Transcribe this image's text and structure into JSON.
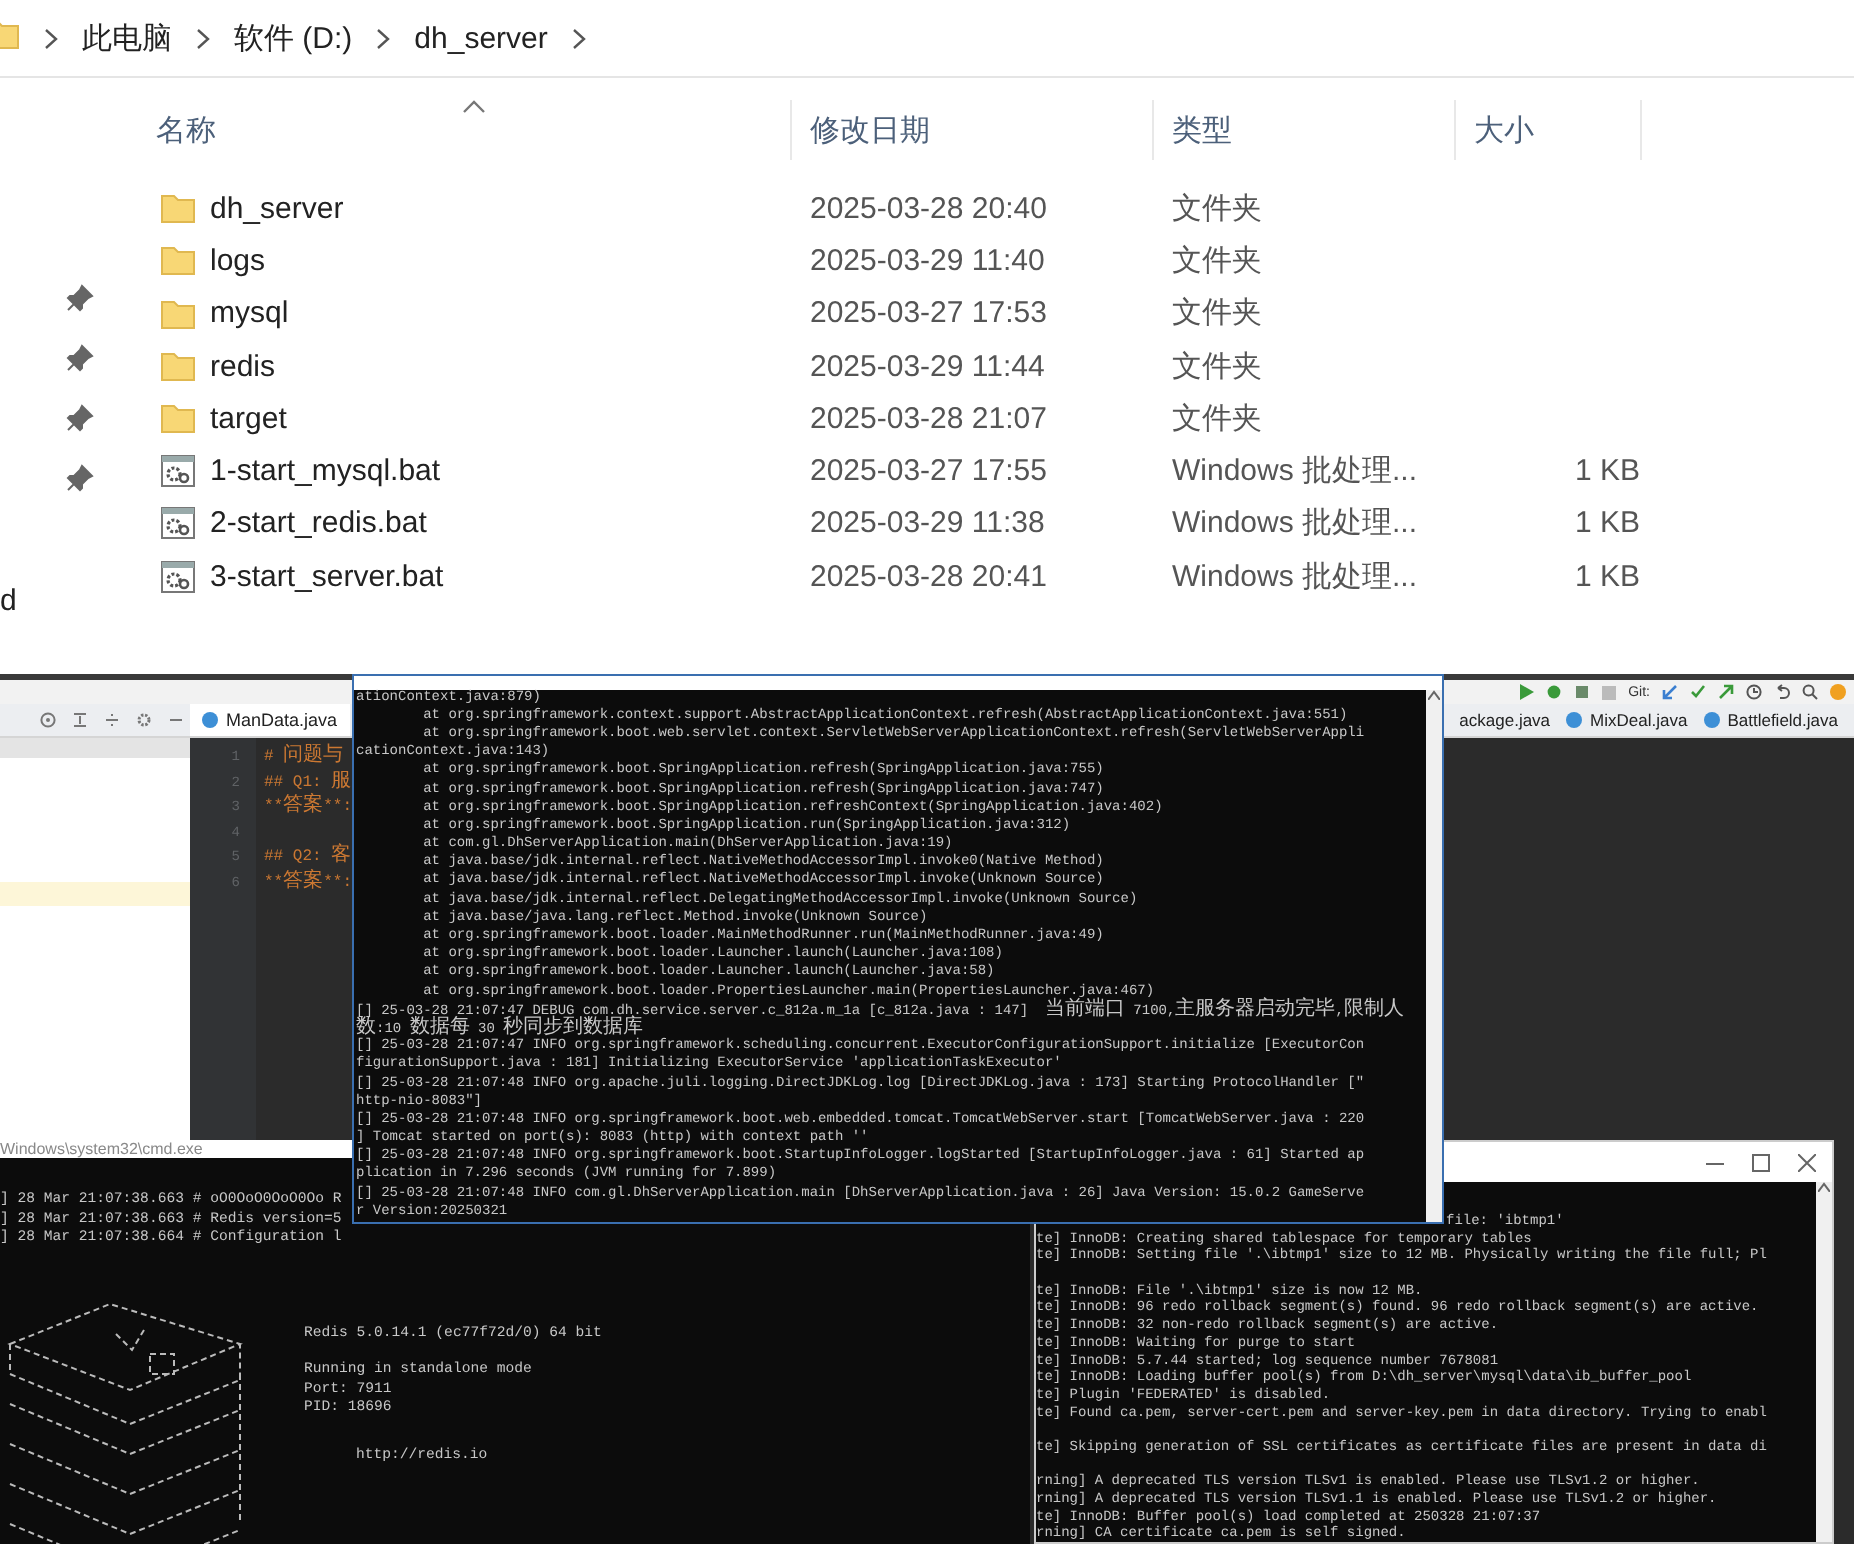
{
  "explorer": {
    "breadcrumb": [
      "此电脑",
      "软件 (D:)",
      "dh_server"
    ],
    "nav_fragment": "d",
    "columns": [
      {
        "label": "名称",
        "sorted": true
      },
      {
        "label": "修改日期",
        "sorted": false
      },
      {
        "label": "类型",
        "sorted": false
      },
      {
        "label": "大小",
        "sorted": false
      }
    ],
    "rows": [
      {
        "kind": "folder",
        "name": "dh_server",
        "date": "2025-03-28 20:40",
        "type": "文件夹"
      },
      {
        "kind": "folder",
        "name": "logs",
        "date": "2025-03-29 11:40",
        "type": "文件夹"
      },
      {
        "kind": "folder",
        "name": "mysql",
        "date": "2025-03-27 17:53",
        "type": "文件夹"
      },
      {
        "kind": "folder",
        "name": "redis",
        "date": "2025-03-29 11:44",
        "type": "文件夹"
      },
      {
        "kind": "folder",
        "name": "target",
        "date": "2025-03-28 21:07",
        "type": "文件夹"
      },
      {
        "kind": "bat",
        "name": "1-start_mysql.bat",
        "date": "2025-03-27 17:55",
        "type": "Windows 批处理...",
        "size": "1 KB"
      },
      {
        "kind": "bat",
        "name": "2-start_redis.bat",
        "date": "2025-03-29 11:38",
        "type": "Windows 批处理...",
        "size": "1 KB"
      },
      {
        "kind": "bat",
        "name": "3-start_server.bat",
        "date": "2025-03-28 20:41",
        "type": "Windows 批处理...",
        "size": "1 KB"
      }
    ]
  },
  "ide": {
    "git_label": "Git:",
    "tab_left": {
      "label": "ManData.java",
      "selected": true
    },
    "tabs_right": [
      {
        "label": "ackage.java",
        "selected": false
      },
      {
        "label": "MixDeal.java",
        "selected": false
      },
      {
        "label": "Battlefield.java",
        "selected": false
      }
    ],
    "code_lines": [
      {
        "number": "1",
        "text": "# 问题与"
      },
      {
        "number": "2",
        "text": "## Q1: 服"
      },
      {
        "number": "3",
        "text": "**答案**:"
      },
      {
        "number": "4"
      },
      {
        "number": "5",
        "text": "## Q2: 客"
      },
      {
        "number": "6",
        "text": "**答案**:"
      }
    ]
  },
  "server_console": {
    "lines": [
      "ationContext.java:879)",
      "        at org.springframework.context.support.AbstractApplicationContext.refresh(AbstractApplicationContext.java:551)",
      "        at org.springframework.boot.web.servlet.context.ServletWebServerApplicationContext.refresh(ServletWebServerAppli",
      "cationContext.java:143)",
      "        at org.springframework.boot.SpringApplication.refresh(SpringApplication.java:755)",
      "        at org.springframework.boot.SpringApplication.refresh(SpringApplication.java:747)",
      "        at org.springframework.boot.SpringApplication.refreshContext(SpringApplication.java:402)",
      "        at org.springframework.boot.SpringApplication.run(SpringApplication.java:312)",
      "        at com.gl.DhServerApplication.main(DhServerApplication.java:19)",
      "        at java.base/jdk.internal.reflect.NativeMethodAccessorImpl.invoke0(Native Method)",
      "        at java.base/jdk.internal.reflect.NativeMethodAccessorImpl.invoke(Unknown Source)",
      "        at java.base/jdk.internal.reflect.DelegatingMethodAccessorImpl.invoke(Unknown Source)",
      "        at java.base/java.lang.reflect.Method.invoke(Unknown Source)",
      "        at org.springframework.boot.loader.MainMethodRunner.run(MainMethodRunner.java:49)",
      "        at org.springframework.boot.loader.Launcher.launch(Launcher.java:108)",
      "        at org.springframework.boot.loader.Launcher.launch(Launcher.java:58)",
      "        at org.springframework.boot.loader.PropertiesLauncher.main(PropertiesLauncher.java:467)",
      "[] 25-03-28 21:07:47 DEBUG com.dh.service.server.c_812a.m_1a [c_812a.java : 147]  当前端口 7100,主服务器启动完毕,限制人",
      "数:10 数据每 30 秒同步到数据库",
      "[] 25-03-28 21:07:47 INFO org.springframework.scheduling.concurrent.ExecutorConfigurationSupport.initialize [ExecutorCon",
      "figurationSupport.java : 181] Initializing ExecutorService 'applicationTaskExecutor'",
      "[] 25-03-28 21:07:48 INFO org.apache.juli.logging.DirectJDKLog.log [DirectJDKLog.java : 173] Starting ProtocolHandler [\"",
      "http-nio-8083\"]",
      "[] 25-03-28 21:07:48 INFO org.springframework.boot.web.embedded.tomcat.TomcatWebServer.start [TomcatWebServer.java : 220",
      "] Tomcat started on port(s): 8083 (http) with context path ''",
      "[] 25-03-28 21:07:48 INFO org.springframework.boot.StartupInfoLogger.logStarted [StartupInfoLogger.java : 61] Started ap",
      "plication in 7.296 seconds (JVM running for 7.899)",
      "[] 25-03-28 21:07:48 INFO com.gl.DhServerApplication.main [DhServerApplication.java : 26] Java Version: 15.0.2 GameServe",
      "r Version:20250321"
    ]
  },
  "redis_console": {
    "title": "Windows\\system32\\cmd.exe",
    "log_lines": [
      "] 28 Mar 21:07:38.663 # oO0OoO0OoO0Oo R",
      "] 28 Mar 21:07:38.663 # Redis version=5",
      "] 28 Mar 21:07:38.664 # Configuration l"
    ],
    "version": "Redis 5.0.14.1 (ec77f72d/0) 64 bit",
    "info_lines": [
      "Running in standalone mode",
      "Port: 7911",
      "PID: 18696"
    ],
    "url": "http://redis.io"
  },
  "mysql_console": {
    "lines": [
      {
        "text": "file: 'ibtmp1'",
        "gap_before": false,
        "indented": true
      },
      {
        "text": "te] InnoDB: Creating shared tablespace for temporary tables",
        "gap_before": false,
        "indented": false
      },
      {
        "text": "te] InnoDB: Setting file '.\\ibtmp1' size to 12 MB. Physically writing the file full; Pl",
        "gap_before": false,
        "indented": false
      },
      {
        "text": "te] InnoDB: File '.\\ibtmp1' size is now 12 MB.",
        "gap_before": true,
        "indented": false
      },
      {
        "text": "te] InnoDB: 96 redo rollback segment(s) found. 96 redo rollback segment(s) are active.",
        "gap_before": false,
        "indented": false
      },
      {
        "text": "te] InnoDB: 32 non-redo rollback segment(s) are active.",
        "gap_before": false,
        "indented": false
      },
      {
        "text": "te] InnoDB: Waiting for purge to start",
        "gap_before": false,
        "indented": false
      },
      {
        "text": "te] InnoDB: 5.7.44 started; log sequence number 7678081",
        "gap_before": false,
        "indented": false
      },
      {
        "text": "te] InnoDB: Loading buffer pool(s) from D:\\dh_server\\mysql\\data\\ib_buffer_pool",
        "gap_before": false,
        "indented": false
      },
      {
        "text": "te] Plugin 'FEDERATED' is disabled.",
        "gap_before": false,
        "indented": false
      },
      {
        "text": "te] Found ca.pem, server-cert.pem and server-key.pem in data directory. Trying to enabl",
        "gap_before": false,
        "indented": false
      },
      {
        "text": "te] Skipping generation of SSL certificates as certificate files are present in data di",
        "gap_before": true,
        "indented": false
      },
      {
        "text": "rning] A deprecated TLS version TLSv1 is enabled. Please use TLSv1.2 or higher.",
        "gap_before": true,
        "indented": false
      },
      {
        "text": "rning] A deprecated TLS version TLSv1.1 is enabled. Please use TLSv1.2 or higher.",
        "gap_before": false,
        "indented": false
      },
      {
        "text": "te] InnoDB: Buffer pool(s) load completed at 250328 21:07:37",
        "gap_before": false,
        "indented": false
      },
      {
        "text": "rning] CA certificate ca.pem is self signed.",
        "gap_before": false,
        "indented": false
      }
    ]
  }
}
